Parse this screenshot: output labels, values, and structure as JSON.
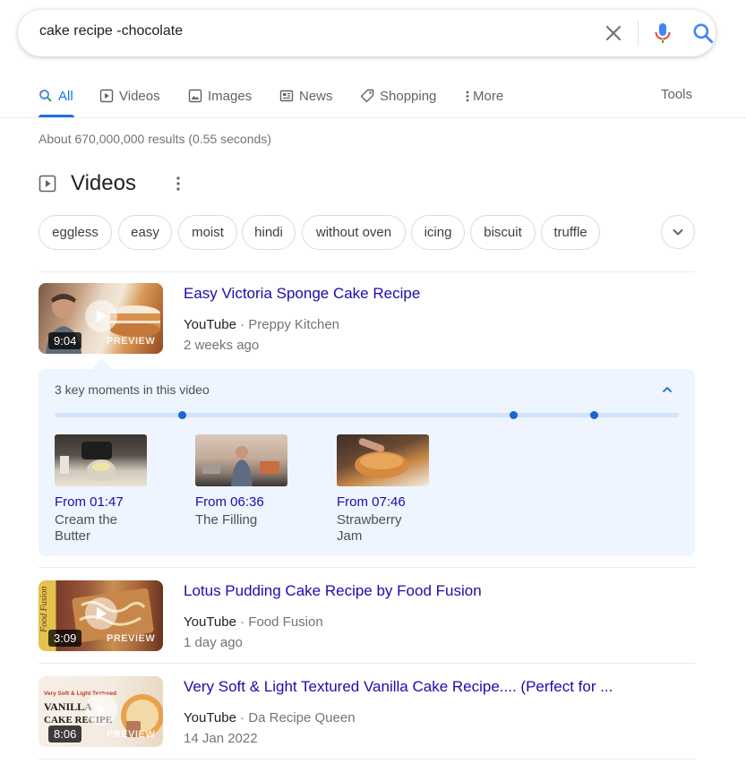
{
  "search": {
    "query": "cake recipe -chocolate"
  },
  "tabs": [
    {
      "label": "All",
      "active": true,
      "icon": "search-icon"
    },
    {
      "label": "Videos",
      "icon": "video-icon"
    },
    {
      "label": "Images",
      "icon": "image-icon"
    },
    {
      "label": "News",
      "icon": "news-icon"
    },
    {
      "label": "Shopping",
      "icon": "tag-icon"
    },
    {
      "label": "More",
      "icon": "more-vert-icon"
    }
  ],
  "tools_label": "Tools",
  "result_stats": "About 670,000,000 results (0.55 seconds)",
  "videos_section": {
    "title": "Videos",
    "chips": [
      "eggless",
      "easy",
      "moist",
      "hindi",
      "without oven",
      "icing",
      "biscuit",
      "truffle"
    ],
    "results": [
      {
        "title": "Easy Victoria Sponge Cake Recipe",
        "source": "YouTube",
        "channel": "Preppy Kitchen",
        "date": "2 weeks ago",
        "duration": "9:04",
        "preview": "PREVIEW",
        "key_moments": {
          "label": "3 key moments in this video",
          "moments": [
            {
              "from": "From 01:47",
              "label": "Cream the Butter"
            },
            {
              "from": "From 06:36",
              "label": "The Filling"
            },
            {
              "from": "From 07:46",
              "label": "Strawberry Jam"
            }
          ]
        }
      },
      {
        "title": "Lotus Pudding Cake Recipe by Food Fusion",
        "source": "YouTube",
        "channel": "Food Fusion",
        "date": "1 day ago",
        "duration": "3:09",
        "preview": "PREVIEW",
        "thumb_text": "Food Fusion"
      },
      {
        "title": "Very Soft & Light Textured Vanilla Cake Recipe.... (Perfect for ...",
        "source": "YouTube",
        "channel": "Da Recipe Queen",
        "date": "14 Jan 2022",
        "duration": "8:06",
        "preview": "PREVIEW",
        "thumb_text_1": "Very Soft & Light Textured",
        "thumb_text_2": "VANILLA",
        "thumb_text_3": "CAKE RECIPE"
      }
    ]
  },
  "colors": {
    "link": "#1a0dab",
    "accent": "#1a73e8",
    "moments_bg": "#eef5fe"
  }
}
